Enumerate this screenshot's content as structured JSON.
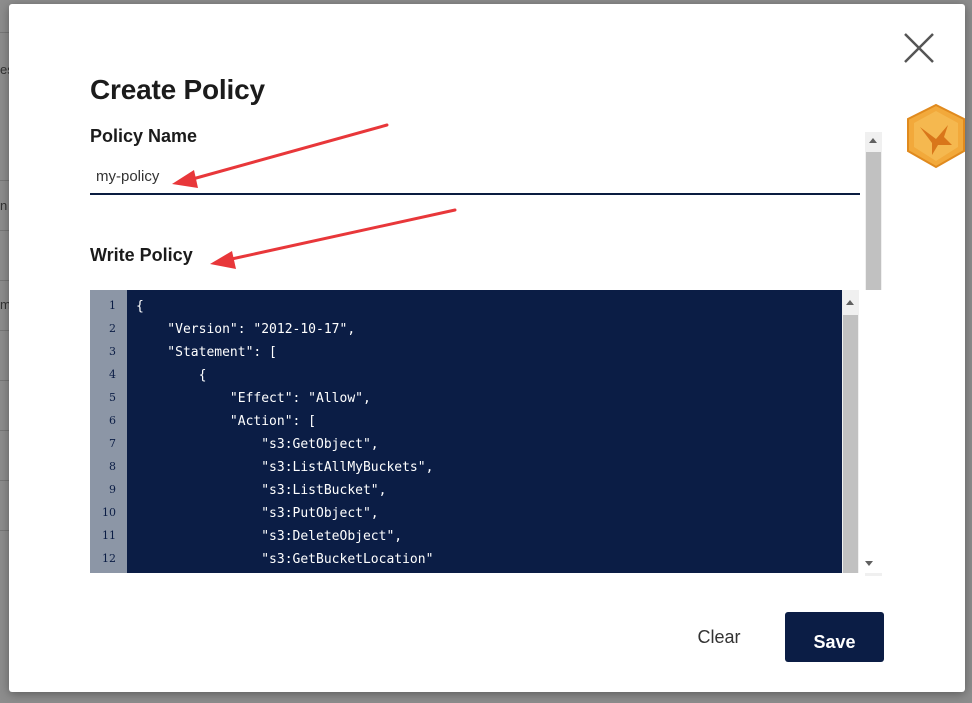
{
  "background_page": {
    "fragments": [
      "es",
      "n",
      "m"
    ]
  },
  "dialog": {
    "title": "Create Policy",
    "policy_name": {
      "label": "Policy Name",
      "value": "my-policy"
    },
    "write_policy": {
      "label": "Write Policy",
      "line_numbers": [
        "1",
        "2",
        "3",
        "4",
        "5",
        "6",
        "7",
        "8",
        "9",
        "10",
        "11",
        "12"
      ],
      "code_lines": [
        "{",
        "    \"Version\": \"2012-10-17\",",
        "    \"Statement\": [",
        "        {",
        "            \"Effect\": \"Allow\",",
        "            \"Action\": [",
        "                \"s3:GetObject\",",
        "                \"s3:ListAllMyBuckets\",",
        "                \"s3:ListBucket\",",
        "                \"s3:PutObject\",",
        "                \"s3:DeleteObject\",",
        "                \"s3:GetBucketLocation\""
      ]
    },
    "buttons": {
      "clear": "Clear",
      "save": "Save"
    },
    "icons": {
      "close": "close-icon",
      "side_badge": "hummingbird-badge-icon"
    }
  },
  "colors": {
    "accent": "#0b1d45",
    "gutter": "#8c96a6",
    "annotation_arrow": "#e8373a",
    "badge": "#f2a93b"
  }
}
